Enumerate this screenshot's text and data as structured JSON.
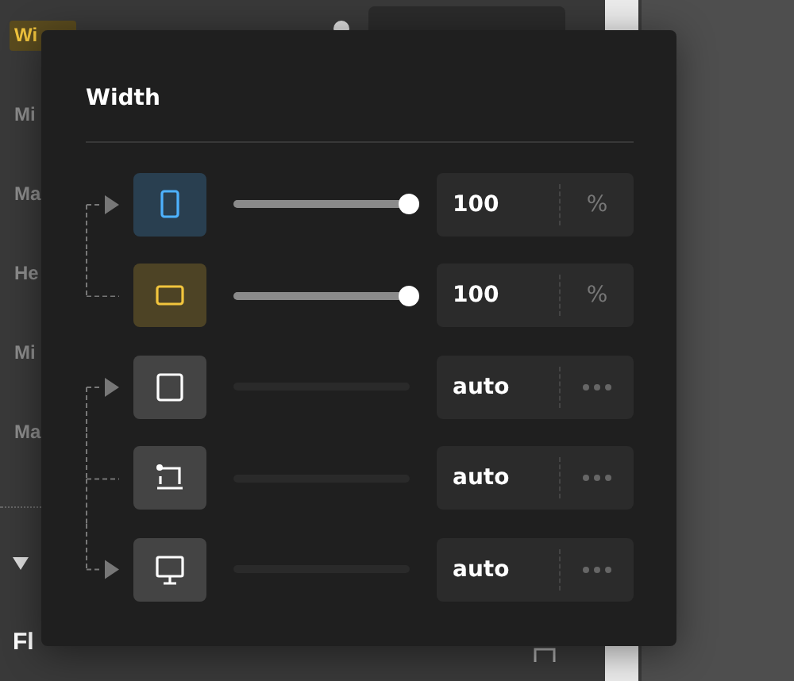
{
  "background_panel": {
    "labels": [
      {
        "text": "Wi",
        "highlighted": true
      },
      {
        "text": "Mi",
        "highlighted": false
      },
      {
        "text": "Ma",
        "highlighted": false
      },
      {
        "text": "He",
        "highlighted": false
      },
      {
        "text": "Mi",
        "highlighted": false
      },
      {
        "text": "Ma",
        "highlighted": false
      }
    ],
    "section": {
      "title": "Fl",
      "expanded": true
    }
  },
  "popup": {
    "title": "Width",
    "rows": [
      {
        "kind": "tablet",
        "color": "#4db2ff",
        "enabled": true,
        "level": 1,
        "value": "100",
        "unit": "%",
        "joined_up": false,
        "joined_down": true,
        "arrow": true
      },
      {
        "kind": "landscape",
        "color": "#f2c53d",
        "enabled": true,
        "level": 1,
        "value": "100",
        "unit": "%",
        "joined_up": true,
        "joined_down": false,
        "arrow": false
      },
      {
        "kind": "square",
        "enabled": false,
        "value": "auto",
        "joined_up": false,
        "joined_down": true,
        "arrow": true
      },
      {
        "kind": "laptop",
        "enabled": false,
        "value": "auto",
        "joined_up": true,
        "joined_down": true,
        "arrow": false
      },
      {
        "kind": "desktop",
        "enabled": false,
        "value": "auto",
        "joined_up": true,
        "joined_down": false,
        "arrow": true
      }
    ]
  }
}
